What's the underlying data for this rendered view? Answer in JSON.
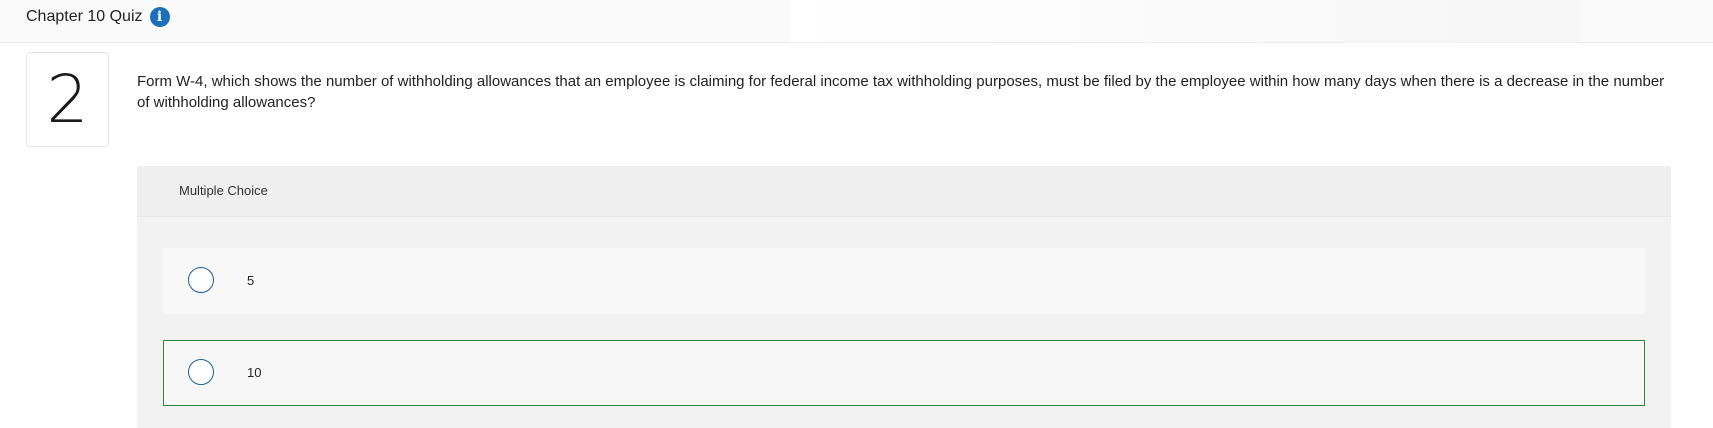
{
  "header": {
    "title": "Chapter 10 Quiz",
    "info_icon": "i"
  },
  "question": {
    "number": "2",
    "text": "Form W-4, which shows the number of withholding allowances that an employee is claiming for federal income tax withholding purposes, must be filed by the employee within how many days when there is a decrease in the number of withholding allowances?"
  },
  "choices": {
    "type_label": "Multiple Choice",
    "options": [
      {
        "label": "5",
        "selected": false
      },
      {
        "label": "10",
        "selected": false
      }
    ]
  },
  "colors": {
    "info_icon": "#1a6fbf",
    "radio_border": "#1a5fa8",
    "highlight_border": "#2e8540"
  },
  "icons": {
    "info": "info-icon",
    "radio": "radio-unchecked-icon"
  }
}
